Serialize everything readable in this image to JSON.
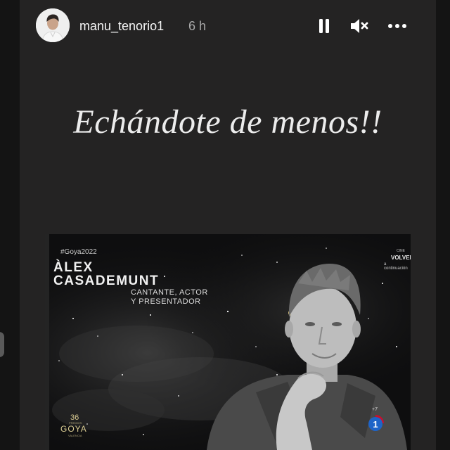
{
  "header": {
    "username": "manu_tenorio1",
    "timestamp": "6 h",
    "icons": [
      "pause-icon",
      "mute-icon",
      "more-icon"
    ]
  },
  "caption": "Echándote de menos!!",
  "photo": {
    "hashtag": "#Goya2022",
    "name_line1": "ÀLEX",
    "name_line2": "CASADEMUNT",
    "role_line1": "CANTANTE, ACTOR",
    "role_line2": "Y PRESENTADOR",
    "next_program": {
      "section": "CINE",
      "title": "VOLVER",
      "note": "a continuación"
    },
    "goya_logo": {
      "number": "36",
      "small": "PREMIOS",
      "word": "GOYA",
      "city": "VALENCIA"
    },
    "channel": {
      "plus": "+7",
      "number": "1"
    }
  },
  "colors": {
    "story_bg": "#242323",
    "caption_text": "#ececec",
    "channel_red": "#c8102e",
    "channel_blue": "#1e64c8"
  }
}
